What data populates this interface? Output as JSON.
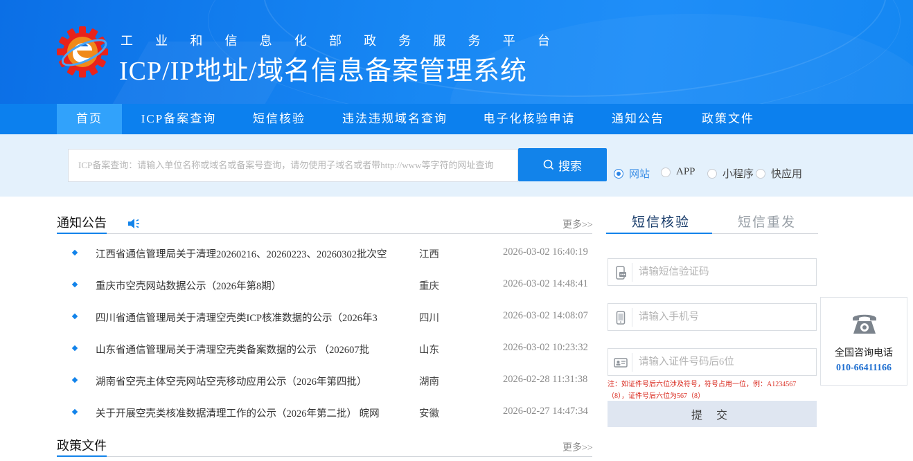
{
  "header": {
    "gov_line": [
      "工",
      "业",
      "和",
      "信",
      "息",
      "化",
      "部",
      "政",
      "务",
      "服",
      "务",
      "平",
      "台"
    ],
    "system_title": "ICP/IP地址/域名信息备案管理系统"
  },
  "nav": {
    "items": [
      {
        "label": "首页",
        "active": true
      },
      {
        "label": "ICP备案查询",
        "active": false
      },
      {
        "label": "短信核验",
        "active": false
      },
      {
        "label": "违法违规域名查询",
        "active": false
      },
      {
        "label": "电子化核验申请",
        "active": false
      },
      {
        "label": "通知公告",
        "active": false
      },
      {
        "label": "政策文件",
        "active": false
      }
    ]
  },
  "search": {
    "placeholder": "ICP备案查询：请输入单位名称或域名或备案号查询，请勿使用子域名或者带http://www等字符的网址查询",
    "button_label": "搜索",
    "options": [
      {
        "label": "网站",
        "checked": true
      },
      {
        "label": "APP",
        "checked": false
      },
      {
        "label": "小程序",
        "checked": false
      },
      {
        "label": "快应用",
        "checked": false
      }
    ]
  },
  "notices": {
    "title": "通知公告",
    "more": "更多>>",
    "items": [
      {
        "title": "江西省通信管理局关于清理20260216、20260223、20260302批次空",
        "region": "江西",
        "time": "2026-03-02 16:40:19"
      },
      {
        "title": "重庆市空壳网站数据公示（2026年第8期）",
        "region": "重庆",
        "time": "2026-03-02 14:48:41"
      },
      {
        "title": "四川省通信管理局关于清理空壳类ICP核准数据的公示（2026年3",
        "region": "四川",
        "time": "2026-03-02 14:08:07"
      },
      {
        "title": "山东省通信管理局关于清理空壳类备案数据的公示 （202607批",
        "region": "山东",
        "time": "2026-03-02 10:23:32"
      },
      {
        "title": "湖南省空壳主体空壳网站空壳移动应用公示（2026年第四批）",
        "region": "湖南",
        "time": "2026-02-28 11:31:38"
      },
      {
        "title": "关于开展空壳类核准数据清理工作的公示（2026年第二批） 皖网",
        "region": "安徽",
        "time": "2026-02-27 14:47:34"
      }
    ]
  },
  "policy": {
    "title": "政策文件",
    "more": "更多>>"
  },
  "sms": {
    "tab_verify": "短信核验",
    "tab_resend": "短信重发",
    "code_placeholder": "请输短信验证码",
    "phone_placeholder": "请输入手机号",
    "id_placeholder": "请输入证件号码后6位",
    "note_line1": "注：如证件号后六位涉及符号，符号占用一位，例：A1234567",
    "note_line2": "（8），证件号后六位为567（8）",
    "submit_label": "提 交"
  },
  "contact": {
    "label": "全国咨询电话",
    "number": "010-66411166"
  },
  "colors": {
    "brand_blue": "#1283ea",
    "nav_blue": "#0c80ee",
    "nav_active": "#31a2fb",
    "search_band": "#e4f1fc",
    "note_red": "#d9281d"
  }
}
